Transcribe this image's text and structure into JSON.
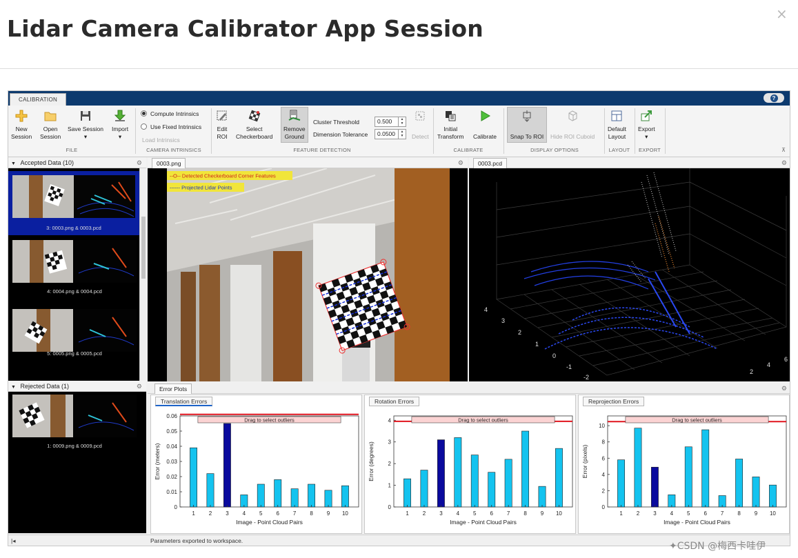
{
  "dialog": {
    "title": "Lidar Camera Calibrator App Session",
    "close_glyph": "×"
  },
  "app": {
    "tab": "CALIBRATION",
    "help": "?",
    "file_group": {
      "label": "FILE",
      "new_session": [
        "New",
        "Session"
      ],
      "open_session": [
        "Open",
        "Session"
      ],
      "save_session": "Save Session",
      "import": "Import"
    },
    "intrinsics_group": {
      "label": "CAMERA INTRINSICS",
      "compute": "Compute Intrinsics",
      "use_fixed": "Use Fixed Intrinsics",
      "load": "Load Intrinsics"
    },
    "feature_group": {
      "label": "FEATURE DETECTION",
      "edit_roi": [
        "Edit",
        "ROI"
      ],
      "select_checkerboard": [
        "Select",
        "Checkerboard"
      ],
      "remove_ground": [
        "Remove",
        "Ground"
      ],
      "cluster_threshold_label": "Cluster Threshold",
      "cluster_threshold_value": "0.500",
      "dimension_tolerance_label": "Dimension Tolerance",
      "dimension_tolerance_value": "0.0500",
      "detect": "Detect"
    },
    "calibrate_group": {
      "label": "CALIBRATE",
      "initial_transform": [
        "Initial",
        "Transform"
      ],
      "calibrate": "Calibrate"
    },
    "display_group": {
      "label": "DISPLAY OPTIONS",
      "snap_to_roi": "Snap To ROI",
      "hide_roi_cuboid": "Hide ROI Cuboid"
    },
    "layout_group": {
      "label": "LAYOUT",
      "default_layout": [
        "Default",
        "Layout"
      ]
    },
    "export_group": {
      "label": "EXPORT",
      "export": "Export"
    },
    "accepted": {
      "header": "Accepted Data (10)",
      "items": [
        "3: 0003.png & 0003.pcd",
        "4: 0004.png & 0004.pcd",
        "5: 0005.png & 0005.pcd"
      ]
    },
    "rejected": {
      "header": "Rejected Data (1)",
      "items": [
        "1: 0009.png & 0009.pcd"
      ]
    },
    "image_tab": "0003.png",
    "pcd_tab": "0003.pcd",
    "legend": {
      "corners": "--O-- Detected Checkerboard Corner Features",
      "lidar": "------ Projected Lidar Points"
    },
    "pcd_ticks_left": [
      "4",
      "3",
      "2",
      "1",
      "0",
      "-1",
      "-2"
    ],
    "pcd_ticks_right": [
      "6",
      "4",
      "2"
    ],
    "error_tab": "Error Plots",
    "status": "Parameters exported to workspace.",
    "nav_left": "|◂"
  },
  "chart_data": [
    {
      "type": "bar",
      "tab": "Translation Errors",
      "banner": "Drag to select outliers",
      "xlabel": "Image - Point Cloud Pairs",
      "ylabel": "Error (meters)",
      "categories": [
        "1",
        "2",
        "3",
        "4",
        "5",
        "6",
        "7",
        "8",
        "9",
        "10"
      ],
      "values": [
        0.039,
        0.022,
        0.055,
        0.008,
        0.015,
        0.018,
        0.012,
        0.015,
        0.011,
        0.014
      ],
      "ylim": [
        0,
        0.06
      ],
      "yticks": [
        "0",
        "0.01",
        "0.02",
        "0.03",
        "0.04",
        "0.05",
        "0.06"
      ],
      "highlight_index": 2,
      "threshold": 0.061,
      "colors": {
        "bar": "#14c3ef",
        "highlight": "#0a0a9e",
        "threshold": "#e0141e"
      }
    },
    {
      "type": "bar",
      "tab": "Rotation Errors",
      "banner": "Drag to select outliers",
      "xlabel": "Image - Point Cloud Pairs",
      "ylabel": "Error (degrees)",
      "categories": [
        "1",
        "2",
        "3",
        "4",
        "5",
        "6",
        "7",
        "8",
        "9",
        "10"
      ],
      "values": [
        1.3,
        1.7,
        3.1,
        3.2,
        2.4,
        1.6,
        2.2,
        3.5,
        0.95,
        2.7
      ],
      "ylim": [
        0,
        4.2
      ],
      "yticks": [
        "0",
        "1",
        "2",
        "3",
        "4"
      ],
      "highlight_index": 2,
      "threshold": 3.95,
      "colors": {
        "bar": "#14c3ef",
        "highlight": "#0a0a9e",
        "threshold": "#e0141e"
      }
    },
    {
      "type": "bar",
      "tab": "Reprojection Errors",
      "banner": "Drag to select outliers",
      "xlabel": "Image - Point Cloud Pairs",
      "ylabel": "Error (pixels)",
      "categories": [
        "1",
        "2",
        "3",
        "4",
        "5",
        "6",
        "7",
        "8",
        "9",
        "10"
      ],
      "values": [
        5.8,
        9.7,
        4.9,
        1.5,
        7.4,
        9.5,
        1.4,
        5.9,
        3.7,
        2.7
      ],
      "ylim": [
        0,
        11.2
      ],
      "yticks": [
        "0",
        "2",
        "4",
        "6",
        "8",
        "10"
      ],
      "highlight_index": 2,
      "threshold": 10.5,
      "colors": {
        "bar": "#14c3ef",
        "highlight": "#0a0a9e",
        "threshold": "#e0141e"
      }
    }
  ],
  "watermark": "CSDN @梅西卡哇伊"
}
